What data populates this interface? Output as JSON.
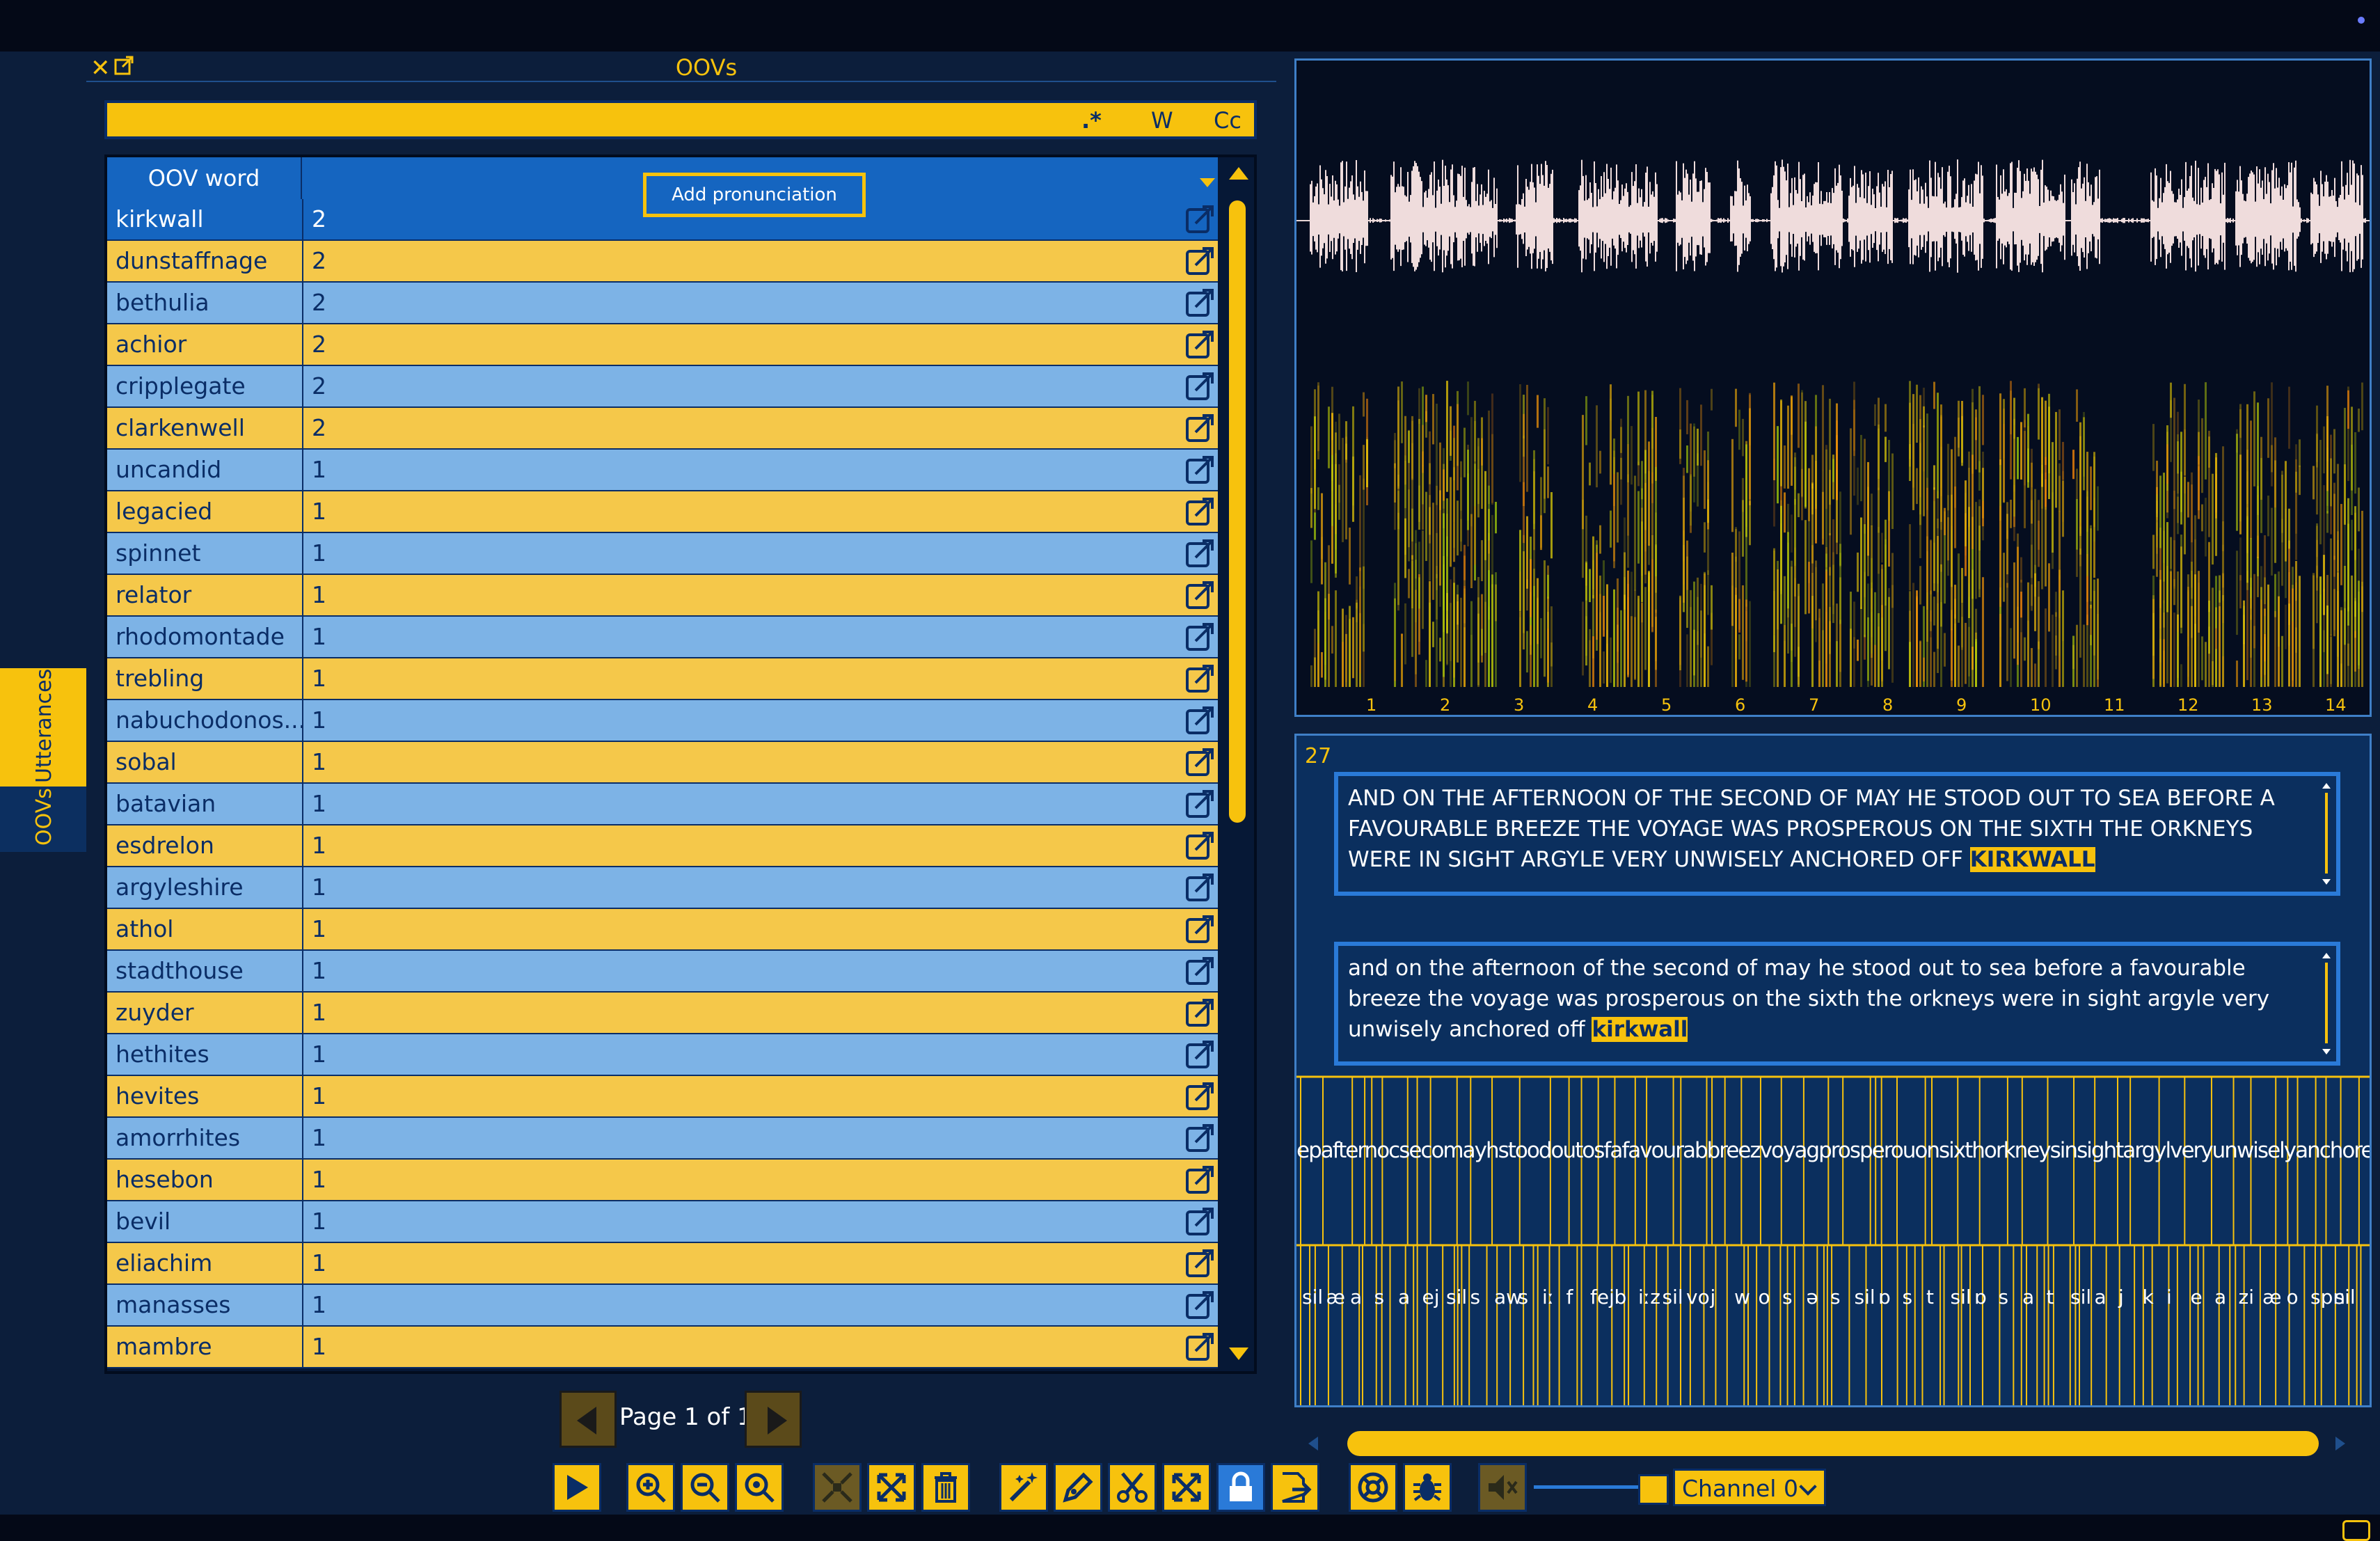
{
  "oov_panel": {
    "title": "OOVs",
    "search": {
      "value": "",
      "placeholder": "",
      "opt_regex": ".*",
      "opt_word": "W",
      "opt_case": "Cc"
    },
    "table": {
      "header_word": "OOV word",
      "tooltip": "Add pronunciation",
      "rows": [
        {
          "word": "kirkwall",
          "count": "2"
        },
        {
          "word": "dunstaffnage",
          "count": "2"
        },
        {
          "word": "bethulia",
          "count": "2"
        },
        {
          "word": "achior",
          "count": "2"
        },
        {
          "word": "cripplegate",
          "count": "2"
        },
        {
          "word": "clarkenwell",
          "count": "2"
        },
        {
          "word": "uncandid",
          "count": "1"
        },
        {
          "word": "legacied",
          "count": "1"
        },
        {
          "word": "spinnet",
          "count": "1"
        },
        {
          "word": "relator",
          "count": "1"
        },
        {
          "word": "rhodomontade",
          "count": "1"
        },
        {
          "word": "trebling",
          "count": "1"
        },
        {
          "word": "nabuchodonos...",
          "count": "1"
        },
        {
          "word": "sobal",
          "count": "1"
        },
        {
          "word": "batavian",
          "count": "1"
        },
        {
          "word": "esdrelon",
          "count": "1"
        },
        {
          "word": "argyleshire",
          "count": "1"
        },
        {
          "word": "athol",
          "count": "1"
        },
        {
          "word": "stadthouse",
          "count": "1"
        },
        {
          "word": "zuyder",
          "count": "1"
        },
        {
          "word": "hethites",
          "count": "1"
        },
        {
          "word": "hevites",
          "count": "1"
        },
        {
          "word": "amorrhites",
          "count": "1"
        },
        {
          "word": "hesebon",
          "count": "1"
        },
        {
          "word": "bevil",
          "count": "1"
        },
        {
          "word": "eliachim",
          "count": "1"
        },
        {
          "word": "manasses",
          "count": "1"
        },
        {
          "word": "mambre",
          "count": "1"
        }
      ]
    },
    "pagination": {
      "label": "Page 1 of 1"
    }
  },
  "side_tabs": {
    "utterances": "Utterances",
    "oovs": "OOVs"
  },
  "waveform": {
    "ticks": [
      "1",
      "2",
      "3",
      "4",
      "5",
      "6",
      "7",
      "8",
      "9",
      "10",
      "11",
      "12",
      "13",
      "14"
    ]
  },
  "transcript": {
    "utterance_number": "27",
    "text_upper_before": "AND ON THE AFTERNOON OF THE SECOND OF MAY HE STOOD OUT TO SEA BEFORE A FAVOURABLE BREEZE THE VOYAGE WAS PROSPEROUS ON THE SIXTH THE ORKNEYS WERE IN SIGHT ARGYLE VERY UNWISELY ANCHORED OFF ",
    "text_upper_highlight": "KIRKWALL",
    "text_lower_before": "and on the afternoon of the second of may he stood out to sea before a favourable breeze the voyage was prosperous on the sixth the orkneys were in sight argyle very unwisely anchored off ",
    "text_lower_highlight": "kirkwall",
    "word_tier": "epafternocsecomayhstoodoutosfafavourabbreezvoyagprosperouonsixthorkneysinsightargylveryunwiselyanchoredoffkirkwall",
    "phone_labels": [
      "sil",
      "æ",
      "a",
      "s",
      "a",
      "ej",
      "sil",
      "s",
      "aw",
      "s",
      "iː",
      "f",
      "fej",
      "b",
      "iːz",
      "sil",
      "vo",
      "j",
      "w",
      "o",
      "s",
      "ə",
      "s",
      "sil",
      "ɒ",
      "s",
      "t",
      "sil",
      "ɒ",
      "s",
      "a",
      "t",
      "sil",
      "a",
      "j",
      "k",
      "i",
      "e",
      "a",
      "zi",
      "æ",
      "o",
      "spn",
      "sil"
    ]
  },
  "toolbar": {
    "channel": "Channel 0"
  },
  "colors": {
    "accent": "#f7c20d",
    "row_blue": "#7db3e6",
    "row_yellow": "#f5c84a",
    "selected": "#1565c0",
    "background": "#0c1e3b"
  }
}
